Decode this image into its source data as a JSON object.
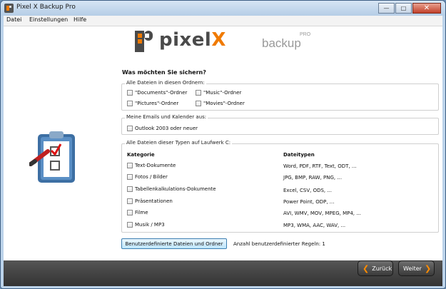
{
  "window": {
    "title": "Pixel X Backup Pro"
  },
  "menu": {
    "items": [
      "Datei",
      "Einstellungen",
      "Hilfe"
    ]
  },
  "brand": {
    "word_main": "pixel",
    "word_accent": "X",
    "product": "backup",
    "product_sup": "PRO"
  },
  "heading": "Was möchten Sie sichern?",
  "folders": {
    "legend": "Alle Dateien in diesen Ordnern:",
    "items": [
      "\"Documents\"-Ordner",
      "\"Music\"-Ordner",
      "\"Pictures\"-Ordner",
      "\"Movies\"-Ordner"
    ]
  },
  "mail": {
    "legend": "Meine Emails und Kalender aus:",
    "items": [
      "Outlook 2003 oder neuer"
    ]
  },
  "types": {
    "legend": "Alle Dateien dieser Typen auf Laufwerk C:",
    "col_category": "Kategorie",
    "col_types": "Dateitypen",
    "rows": [
      {
        "category": "Text-Dokumente",
        "types": "Word, PDF, RTF, Text, ODT, ..."
      },
      {
        "category": "Fotos / Bilder",
        "types": "JPG, BMP, RAW, PNG, ..."
      },
      {
        "category": "Tabellenkalkulations-Dokumente",
        "types": "Excel, CSV, ODS, ..."
      },
      {
        "category": "Präsentationen",
        "types": "Power Point, ODP, ..."
      },
      {
        "category": "Filme",
        "types": "AVI, WMV, MOV, MPEG, MP4, ..."
      },
      {
        "category": "Musik / MP3",
        "types": "MP3, WMA, AAC, WAV, ..."
      }
    ]
  },
  "custom": {
    "button": "Benutzerdefinierte Dateien und Ordner",
    "rules_text": "Anzahl benutzerdefinierter Regeln: 1"
  },
  "nav": {
    "back": "Zurück",
    "next": "Weiter"
  },
  "colors": {
    "accent": "#f07a00",
    "footer": "#3a3a3a",
    "titlebar": "#bcd3ea"
  }
}
